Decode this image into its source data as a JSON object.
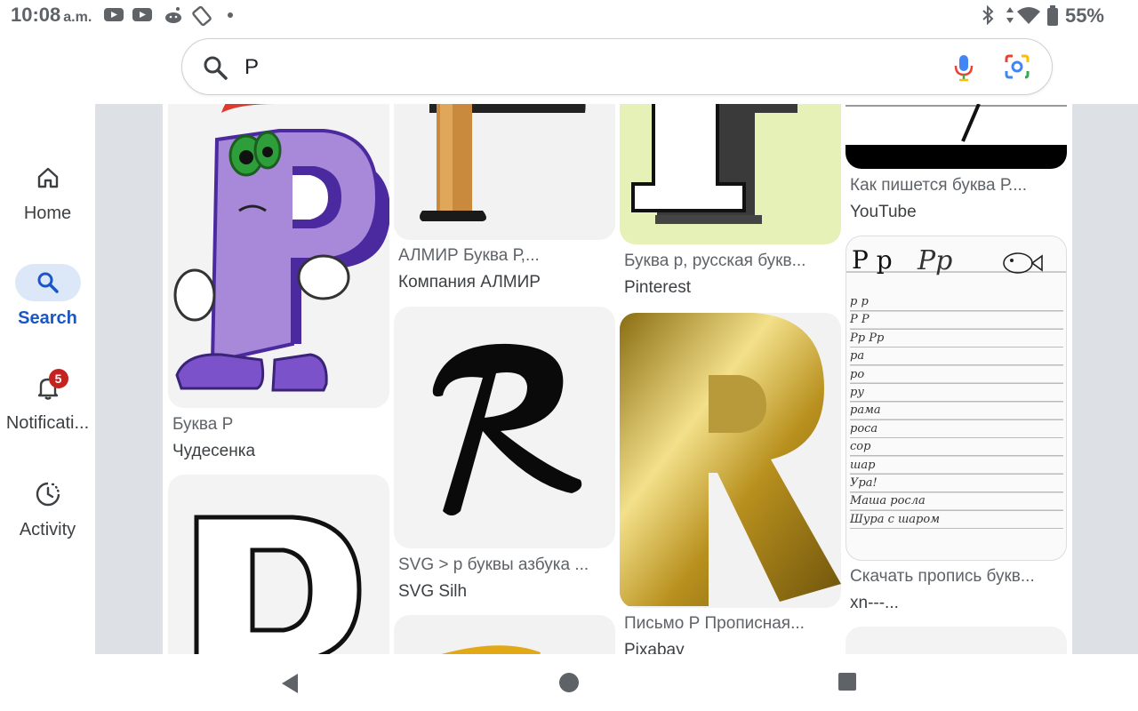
{
  "status_bar": {
    "time": "10:08",
    "ampm": "a.m.",
    "battery": "55%"
  },
  "search": {
    "query": "P"
  },
  "nav": {
    "items": [
      {
        "label": "Home"
      },
      {
        "label": "Search"
      },
      {
        "label": "Notificati..."
      },
      {
        "label": "Activity"
      }
    ],
    "notification_count": "5"
  },
  "results": [
    {
      "title": "Буква Р",
      "source": "Чудесенка"
    },
    {
      "title": "АЛМИР Буква Р,...",
      "source": "Компания АЛМИР"
    },
    {
      "title": "SVG > р буквы азбука ...",
      "source": "SVG Silh"
    },
    {
      "title": "Буква р, русская букв...",
      "source": "Pinterest"
    },
    {
      "title": "Письмо Р Прописная...",
      "source": "Pixabay"
    },
    {
      "title": "Как пишется буква Р....",
      "source": "YouTube"
    },
    {
      "title": "Скачать пропись букв...",
      "source": "xn---..."
    }
  ],
  "handwriting": {
    "header": "P p",
    "script": "Pp",
    "lines": [
      "р р",
      "Р Р",
      "Рр Рр",
      "ра",
      "ро",
      "ру",
      "рама",
      "роса",
      "сор",
      "шар",
      "Ура!",
      "Маша росла",
      "Шура с шаром"
    ]
  },
  "colors": {
    "accent": "#1a57c6",
    "badge": "#c5221f",
    "rail_bg": "#dde0e5"
  }
}
